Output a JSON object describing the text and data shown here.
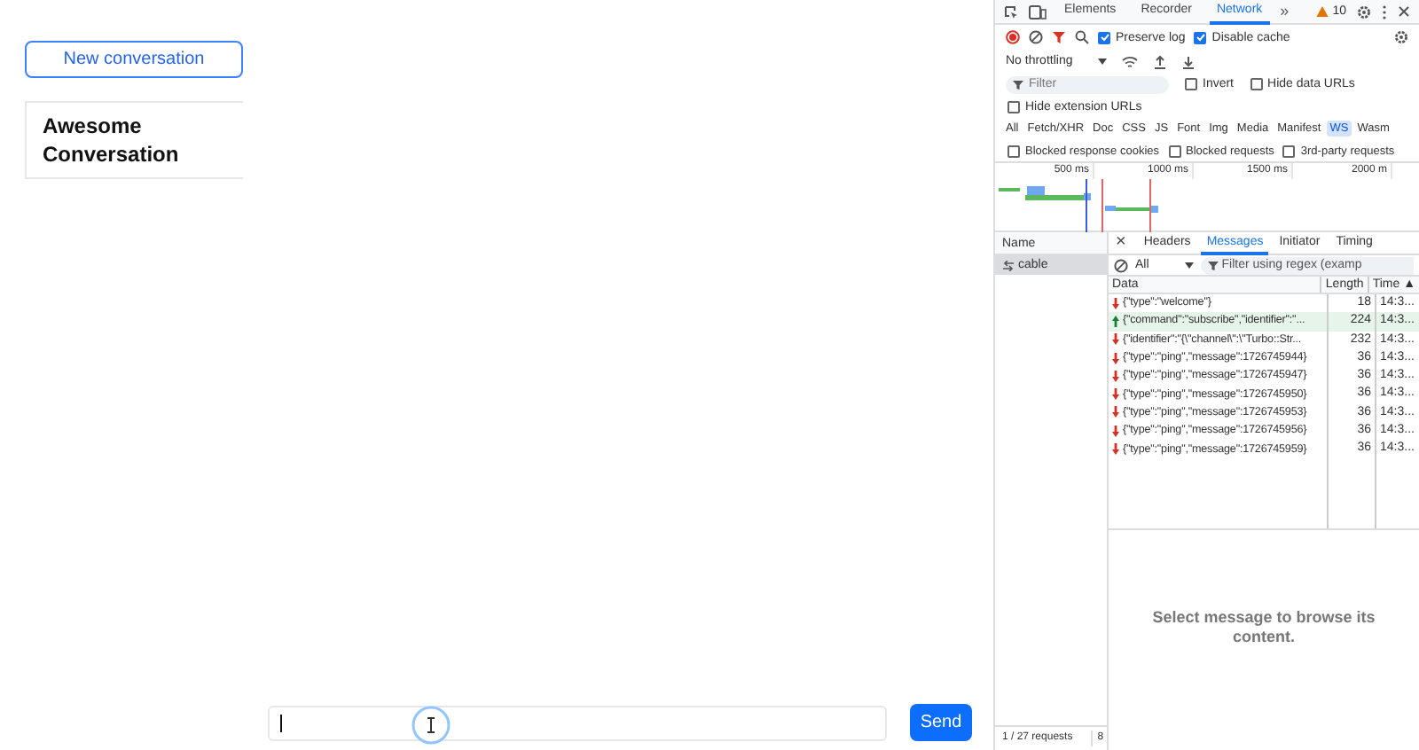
{
  "app": {
    "new_button": "New conversation",
    "conversations": [
      {
        "title": "Awesome Conversation"
      }
    ],
    "send_button": "Send"
  },
  "devtools": {
    "tabs": [
      {
        "label": "Elements",
        "selected": false
      },
      {
        "label": "Recorder",
        "selected": false
      },
      {
        "label": "Network",
        "selected": true
      }
    ],
    "more_tabs": "»",
    "warning_count": "10",
    "toolbar": {
      "recording": true,
      "preserve_log": {
        "label": "Preserve log",
        "checked": true
      },
      "disable_cache": {
        "label": "Disable cache",
        "checked": true
      }
    },
    "throttling": "No throttling",
    "filter": {
      "placeholder": "Filter"
    },
    "filter_options": [
      {
        "label": "Invert",
        "checked": false
      },
      {
        "label": "Hide data URLs",
        "checked": false
      }
    ],
    "hide_extension_urls": {
      "label": "Hide extension URLs",
      "checked": false
    },
    "type_filters": [
      {
        "label": "All",
        "selected": false
      },
      {
        "label": "Fetch/XHR",
        "selected": false
      },
      {
        "label": "Doc",
        "selected": false
      },
      {
        "label": "CSS",
        "selected": false
      },
      {
        "label": "JS",
        "selected": false
      },
      {
        "label": "Font",
        "selected": false
      },
      {
        "label": "Img",
        "selected": false
      },
      {
        "label": "Media",
        "selected": false
      },
      {
        "label": "Manifest",
        "selected": false
      },
      {
        "label": "WS",
        "selected": true
      },
      {
        "label": "Wasm",
        "selected": false
      }
    ],
    "blocked_options": [
      {
        "label": "Blocked response cookies",
        "checked": false
      },
      {
        "label": "Blocked requests",
        "checked": false
      },
      {
        "label": "3rd-party requests",
        "checked": false
      }
    ],
    "timeline_ticks": [
      "500 ms",
      "1000 ms",
      "1500 ms",
      "2000 m"
    ],
    "name_header": "Name",
    "requests": [
      {
        "name": "cable",
        "selected": true
      }
    ],
    "close_glyph": "×",
    "detail_tabs": [
      {
        "label": "Headers",
        "selected": false
      },
      {
        "label": "Messages",
        "selected": true
      },
      {
        "label": "Initiator",
        "selected": false
      },
      {
        "label": "Timing",
        "selected": false
      }
    ],
    "message_filter": {
      "type": "All",
      "placeholder": "Filter using regex (examp"
    },
    "columns": [
      "Data",
      "Length",
      "Time ▲"
    ],
    "messages": [
      {
        "kind": "received",
        "data": "{\"type\":\"welcome\"}",
        "length": "18",
        "time": "14:3..."
      },
      {
        "kind": "sent",
        "data": "{\"command\":\"subscribe\",\"identifier\":\"...",
        "length": "224",
        "time": "14:3..."
      },
      {
        "kind": "received",
        "data": "{\"identifier\":\"{\\\"channel\\\":\\\"Turbo::Str...",
        "length": "232",
        "time": "14:3..."
      },
      {
        "kind": "received",
        "data": "{\"type\":\"ping\",\"message\":1726745944}",
        "length": "36",
        "time": "14:3..."
      },
      {
        "kind": "received",
        "data": "{\"type\":\"ping\",\"message\":1726745947}",
        "length": "36",
        "time": "14:3..."
      },
      {
        "kind": "received",
        "data": "{\"type\":\"ping\",\"message\":1726745950}",
        "length": "36",
        "time": "14:3..."
      },
      {
        "kind": "received",
        "data": "{\"type\":\"ping\",\"message\":1726745953}",
        "length": "36",
        "time": "14:3..."
      },
      {
        "kind": "received",
        "data": "{\"type\":\"ping\",\"message\":1726745956}",
        "length": "36",
        "time": "14:3..."
      },
      {
        "kind": "received",
        "data": "{\"type\":\"ping\",\"message\":1726745959}",
        "length": "36",
        "time": "14:3..."
      }
    ],
    "empty_detail": "Select message to browse its content.",
    "status": [
      "1 / 27 requests",
      "8"
    ]
  }
}
